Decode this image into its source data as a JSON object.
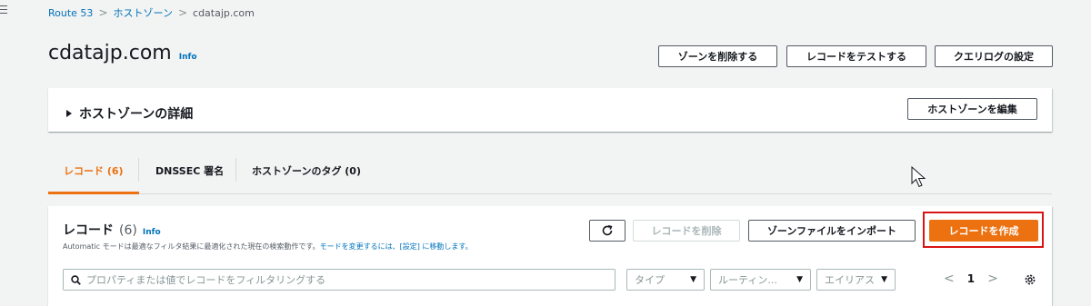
{
  "breadcrumb": {
    "root": "Route 53",
    "sep1": ">",
    "section": "ホストゾーン",
    "sep2": ">",
    "current": "cdatajp.com"
  },
  "header": {
    "title": "cdatajp.com",
    "info": "Info",
    "buttons": {
      "delete_zone": "ゾーンを削除する",
      "test_record": "レコードをテストする",
      "query_logging": "クエリログの設定"
    }
  },
  "details": {
    "title": "ホストゾーンの詳細",
    "edit_button": "ホストゾーンを編集"
  },
  "tabs": {
    "records": "レコード (6)",
    "dnssec": "DNSSEC 署名",
    "tags": "ホストゾーンのタグ (0)"
  },
  "records": {
    "title": "レコード",
    "count": "(6)",
    "info": "Info",
    "desc_prefix": "Automatic モードは最適なフィルタ結果に最適化された現在の検索動作です。",
    "desc_link": "モードを変更するには、[設定] に移動します。",
    "refresh_icon": "refresh-icon",
    "delete_button": "レコードを削除",
    "import_button": "ゾーンファイルをインポート",
    "create_button": "レコードを作成",
    "search_placeholder": "プロパティまたは値でレコードをフィルタリングする",
    "filters": {
      "type": "タイプ",
      "routing": "ルーティン...",
      "alias": "エイリアス"
    },
    "pager": {
      "prev": "<",
      "page": "1",
      "next": ">"
    }
  },
  "colors": {
    "accent": "#ec7211",
    "link": "#0073bb",
    "highlight": "#d91515"
  }
}
